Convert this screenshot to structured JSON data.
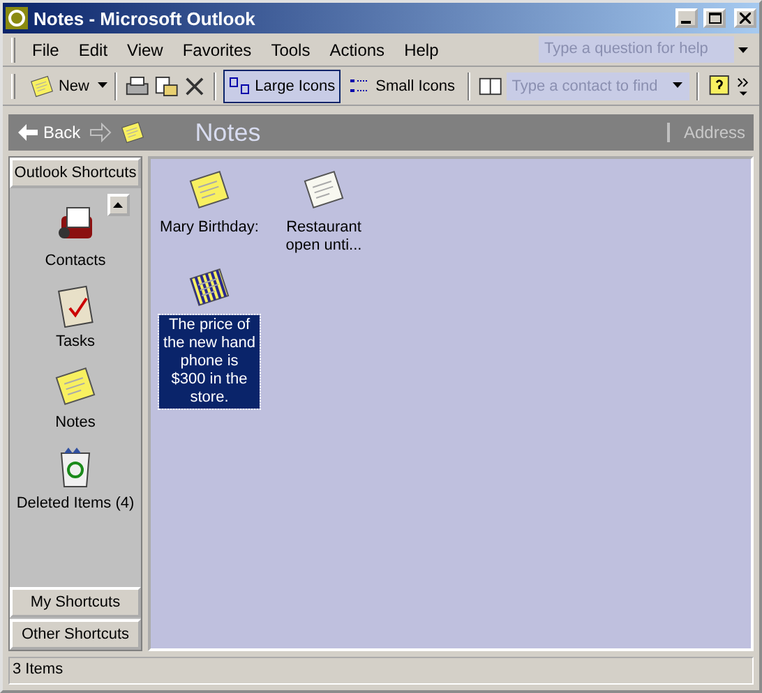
{
  "window": {
    "title": "Notes - Microsoft Outlook"
  },
  "menu": {
    "items": [
      "File",
      "Edit",
      "View",
      "Favorites",
      "Tools",
      "Actions",
      "Help"
    ],
    "help_placeholder": "Type a question for help"
  },
  "toolbar": {
    "new_label": "New",
    "views": [
      {
        "label": "Large Icons",
        "selected": true
      },
      {
        "label": "Small Icons",
        "selected": false
      }
    ],
    "contact_placeholder": "Type a contact to find"
  },
  "banner": {
    "back": "Back",
    "folder": "Notes",
    "address": "Address"
  },
  "sidebar": {
    "header": "Outlook Shortcuts",
    "items": [
      {
        "kind": "contacts",
        "label": "Contacts"
      },
      {
        "kind": "tasks",
        "label": "Tasks"
      },
      {
        "kind": "notes",
        "label": "Notes"
      },
      {
        "kind": "deleted",
        "label": "Deleted Items (4)"
      }
    ],
    "groups": [
      "My Shortcuts",
      "Other Shortcuts"
    ]
  },
  "notes": [
    {
      "label": "Mary Birthday:",
      "color": "#f8f060",
      "selected": false
    },
    {
      "label": "Restaurant open unti...",
      "color": "#f8f8f0",
      "selected": false
    },
    {
      "label": "The price of the new hand phone is $300 in the store.",
      "color": "#f8f060",
      "selected": true
    }
  ],
  "status_bar": {
    "text": "3 Items"
  }
}
